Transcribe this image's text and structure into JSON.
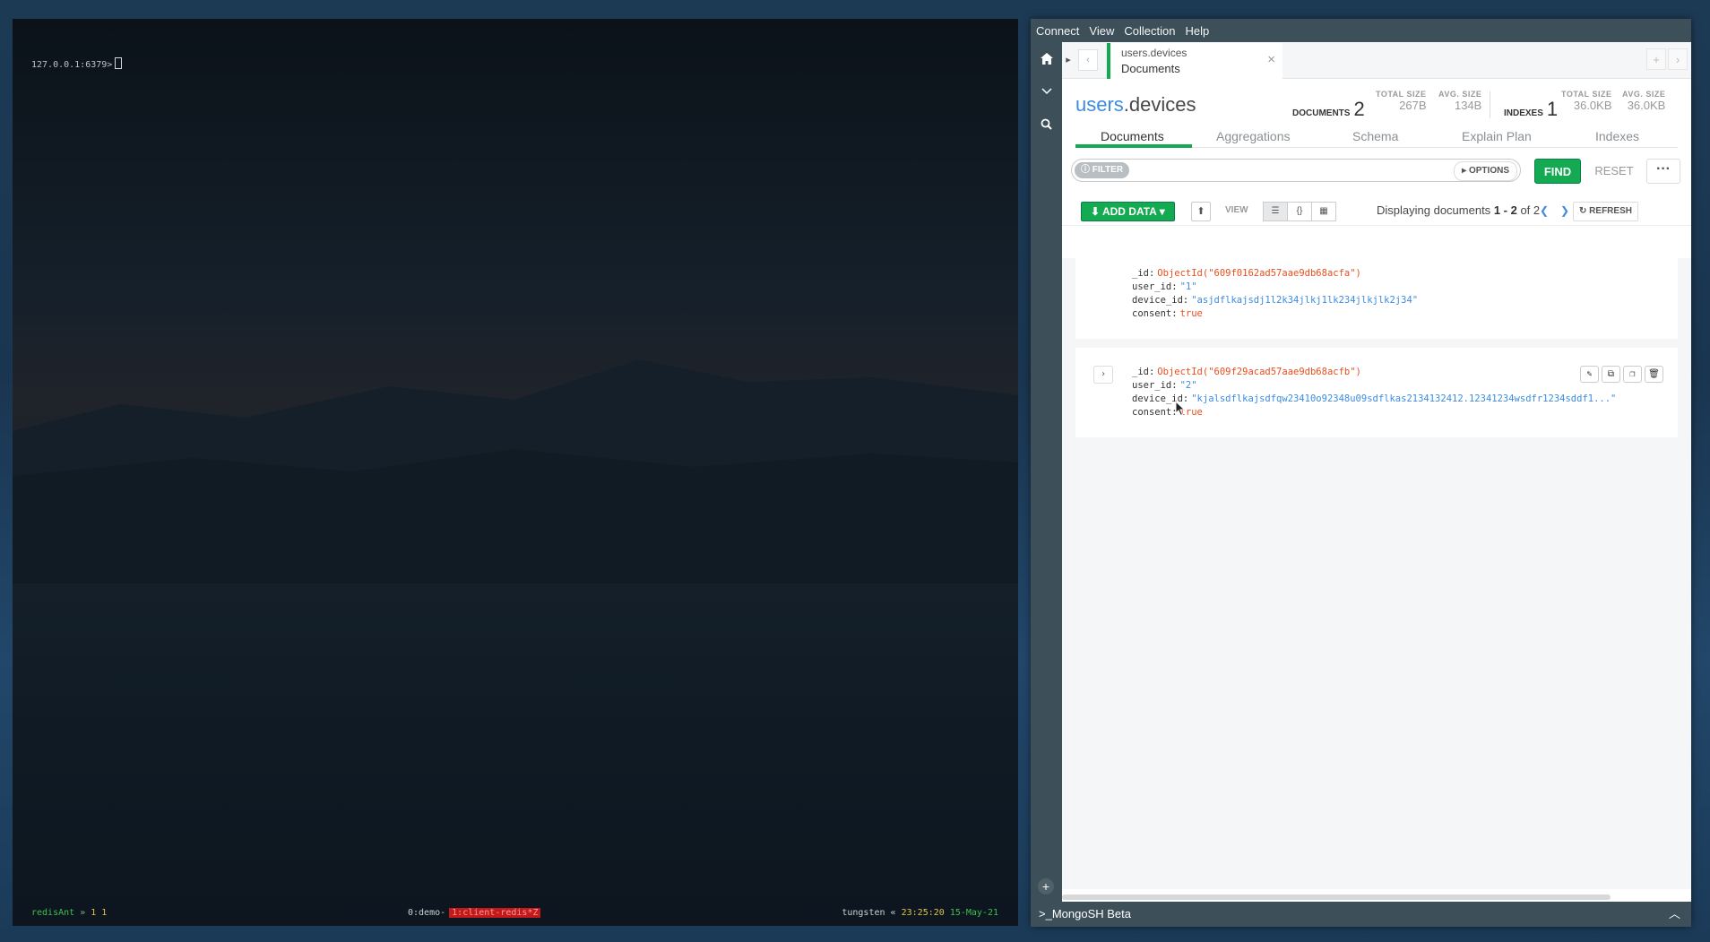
{
  "terminal": {
    "prompt": "127.0.0.1:6379>",
    "status_left_name": "redisAnt",
    "status_left_sep": "»",
    "status_left_nums": "1 1",
    "window_inactive": "0:demo-",
    "window_active": "1:client-redis*Z",
    "host": "tungsten",
    "host_sep": "«",
    "time": "23:25:20",
    "date": "15-May-21"
  },
  "compass": {
    "menu": [
      "Connect",
      "View",
      "Collection",
      "Help"
    ],
    "tab": {
      "namespace": "users.devices",
      "subtitle": "Documents",
      "close": "×"
    },
    "collection": {
      "db": "users",
      "name": ".devices"
    },
    "stats": {
      "documents_label": "DOCUMENTS",
      "documents_value": "2",
      "total_size_label": "TOTAL SIZE",
      "total_size_value": "267B",
      "avg_size_label": "AVG. SIZE",
      "avg_size_value": "134B",
      "indexes_label": "INDEXES",
      "indexes_value": "1",
      "idx_total_size_label": "TOTAL SIZE",
      "idx_total_size_value": "36.0KB",
      "idx_avg_size_label": "AVG. SIZE",
      "idx_avg_size_value": "36.0KB"
    },
    "subtabs": [
      "Documents",
      "Aggregations",
      "Schema",
      "Explain Plan",
      "Indexes"
    ],
    "query": {
      "filter_label": "FILTER",
      "options_label": "OPTIONS",
      "find_label": "FIND",
      "reset_label": "RESET",
      "more_label": "···"
    },
    "toolbar": {
      "add_data_label": "ADD DATA",
      "view_label": "VIEW",
      "display_prefix": "Displaying documents",
      "display_range": "1 - 2",
      "display_of": "of 2",
      "refresh_label": "REFRESH"
    },
    "documents": [
      {
        "id_key": "_id",
        "id_value": "ObjectId(\"609f0162ad57aae9db68acfa\")",
        "user_id_key": "user_id",
        "user_id_value": "\"1\"",
        "device_id_key": "device_id",
        "device_id_value": "\"asjdflkajsdj1l2k34jlkj1lk234jlkjlk2j34\"",
        "consent_key": "consent",
        "consent_value": "true"
      },
      {
        "id_key": "_id",
        "id_value": "ObjectId(\"609f29acad57aae9db68acfb\")",
        "user_id_key": "user_id",
        "user_id_value": "\"2\"",
        "device_id_key": "device_id",
        "device_id_value": "\"kjalsdflkajsdfqw23410o92348u09sdflkas2134132412.12341234wsdfr1234sddf1...\"",
        "consent_key": "consent",
        "consent_value": "true"
      }
    ],
    "mongosh_label": ">_MongoSH Beta"
  },
  "icons": [
    "home-icon",
    "chevron-down-icon",
    "search-icon",
    "plus-icon",
    "edit-icon",
    "clone-icon",
    "copy-icon",
    "trash-icon",
    "list-view-icon",
    "json-view-icon",
    "table-view-icon",
    "export-icon",
    "refresh-icon",
    "caret-up-icon"
  ]
}
